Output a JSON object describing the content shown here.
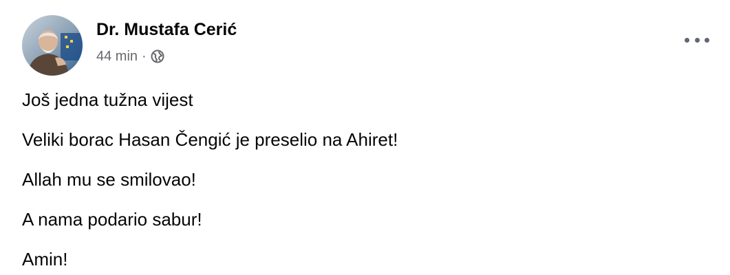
{
  "post": {
    "author": "Dr. Mustafa Cerić",
    "time": "44 min",
    "separator": "·",
    "privacy_icon": "globe-icon",
    "menu_icon": "more-options-icon",
    "lines": [
      "Još jedna tužna vijest",
      "Veliki borac Hasan Čengić je preselio na Ahiret!",
      "Allah mu se smilovao!",
      "A nama podario sabur!",
      "Amin!"
    ]
  },
  "colors": {
    "text_primary": "#050505",
    "text_secondary": "#65676b"
  }
}
